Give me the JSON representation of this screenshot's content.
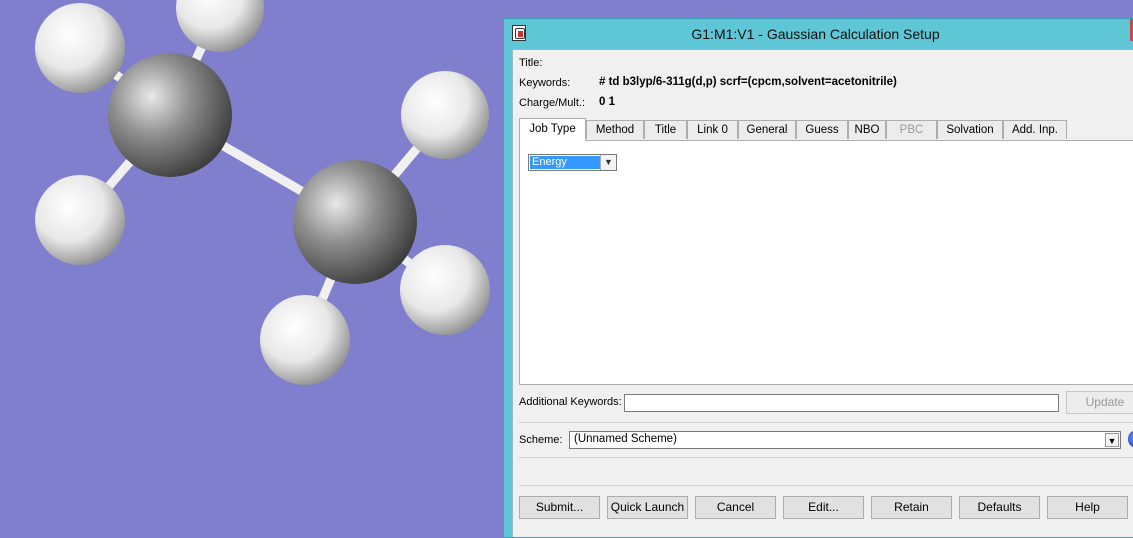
{
  "window": {
    "title": "G1:M1:V1 - Gaussian Calculation Setup"
  },
  "fields": {
    "title_label": "Title:",
    "title_value": "",
    "keywords_label": "Keywords:",
    "keywords_value": "# td b3lyp/6-311g(d,p) scrf=(cpcm,solvent=acetonitrile)",
    "charge_label": "Charge/Mult.:",
    "charge_value": "0 1"
  },
  "tabs": [
    {
      "label": "Job Type",
      "active": true
    },
    {
      "label": "Method"
    },
    {
      "label": "Title"
    },
    {
      "label": "Link 0"
    },
    {
      "label": "General"
    },
    {
      "label": "Guess"
    },
    {
      "label": "NBO"
    },
    {
      "label": "PBC",
      "disabled": true
    },
    {
      "label": "Solvation"
    },
    {
      "label": "Add. Inp."
    }
  ],
  "job_type": {
    "selected": "Energy"
  },
  "additional_keywords": {
    "label": "Additional Keywords:",
    "value": "",
    "update_label": "Update"
  },
  "scheme": {
    "label": "Scheme:",
    "value": "(Unnamed Scheme)"
  },
  "buttons": {
    "submit": "Submit...",
    "quick_launch": "Quick Launch",
    "cancel": "Cancel",
    "edit": "Edit...",
    "retain": "Retain",
    "defaults": "Defaults",
    "help": "Help"
  },
  "colors": {
    "viewport_bg": "#7f7fce",
    "window_frame": "#5fc6d6",
    "selection": "#3399ff",
    "carbon": "#808080",
    "hydrogen": "#ffffff"
  }
}
